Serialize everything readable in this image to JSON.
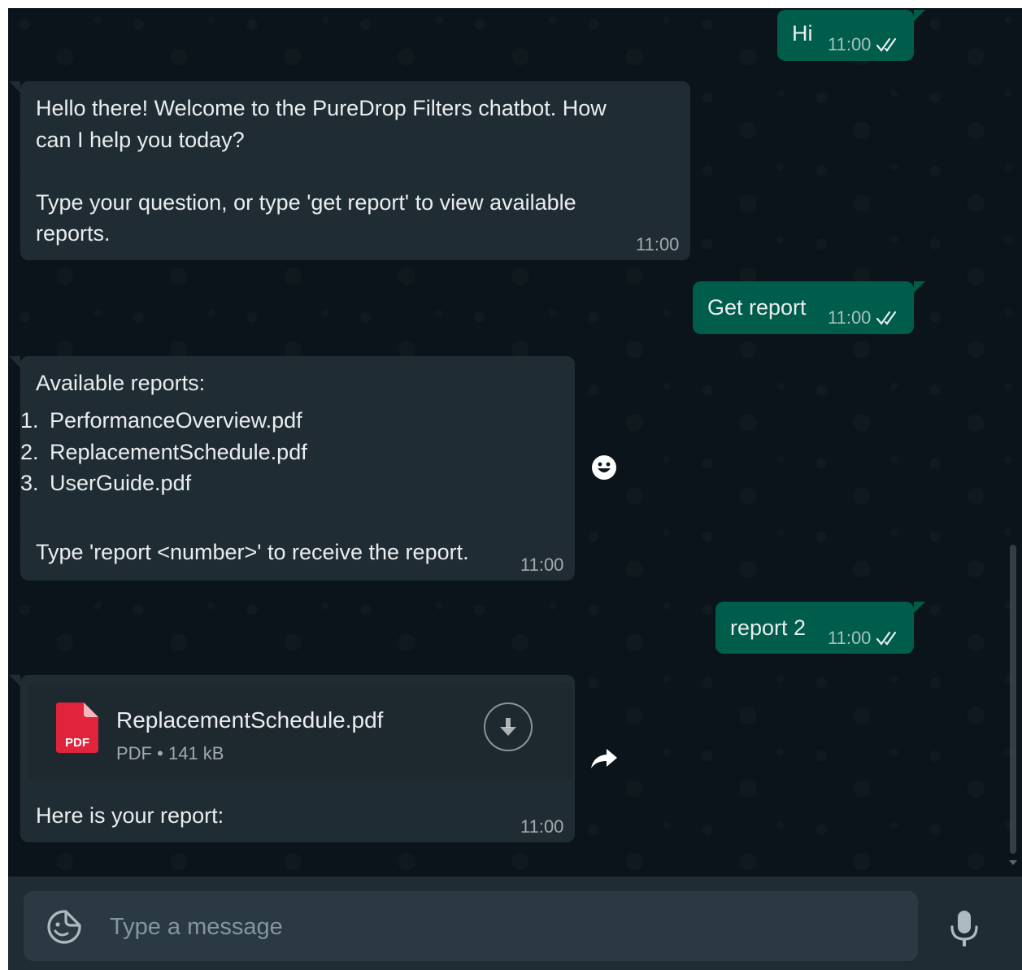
{
  "messages": {
    "m1": {
      "text": "Hi",
      "time": "11:00"
    },
    "m2": {
      "text": "Hello there! Welcome to the PureDrop Filters chatbot. How\ncan I help you today?\n\nType your question, or type 'get report' to view available\nreports.",
      "time": "11:00"
    },
    "m3": {
      "text": "Get report",
      "time": "11:00"
    },
    "m4": {
      "heading": "Available reports:",
      "reports": [
        "PerformanceOverview.pdf",
        "ReplacementSchedule.pdf",
        "UserGuide.pdf"
      ],
      "footer": "Type 'report <number>' to receive the report.",
      "time": "11:00"
    },
    "m5": {
      "text": "report 2",
      "time": "11:00"
    },
    "m6": {
      "document": {
        "icon_label": "PDF",
        "name": "ReplacementSchedule.pdf",
        "type": "PDF",
        "size": "141 kB"
      },
      "caption": "Here is your report:",
      "time": "11:00"
    }
  },
  "composer": {
    "placeholder": "Type a message"
  },
  "icons": {
    "ticks": "double-check-icon",
    "react": "smiley-icon",
    "forward": "forward-arrow-icon",
    "download": "download-icon",
    "sticker": "sticker-icon",
    "mic": "microphone-icon"
  },
  "colors": {
    "chat_bg": "#0b141a",
    "incoming": "#202c33",
    "outgoing": "#005c4b",
    "pdf_red": "#e0243b",
    "tick_color": "#e9edef"
  }
}
